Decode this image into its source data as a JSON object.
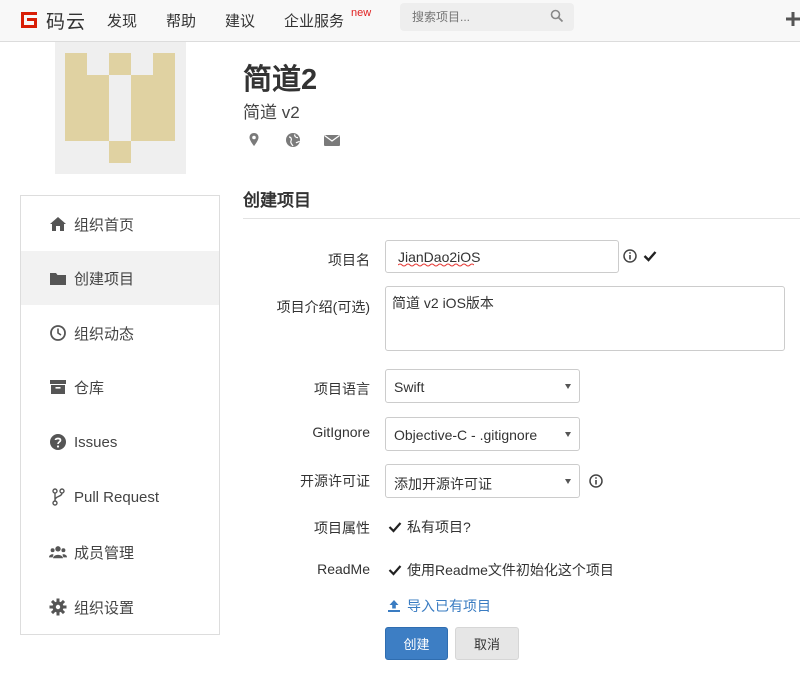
{
  "header": {
    "logo_text": "码云",
    "nav": [
      {
        "label": "发现"
      },
      {
        "label": "帮助"
      },
      {
        "label": "建议"
      },
      {
        "label": "企业服务"
      }
    ],
    "nav_badge": "new",
    "search_placeholder": "搜索项目...",
    "icons": {
      "search": "search-icon",
      "plus": "plus-icon",
      "logo": "gitee-logo"
    }
  },
  "org": {
    "name": "简道2",
    "subtitle": "简道 v2",
    "icons": [
      "map-marker-icon",
      "globe-icon",
      "envelope-icon"
    ],
    "avatar_color": "#e0d2a2"
  },
  "sidebar": {
    "items": [
      {
        "label": "组织首页",
        "icon": "home-icon",
        "active": false
      },
      {
        "label": "创建项目",
        "icon": "folder-icon",
        "active": true
      },
      {
        "label": "组织动态",
        "icon": "clock-icon",
        "active": false
      },
      {
        "label": "仓库",
        "icon": "archive-icon",
        "active": false
      },
      {
        "label": "Issues",
        "icon": "question-circle-icon",
        "active": false
      },
      {
        "label": "Pull Request",
        "icon": "code-fork-icon",
        "active": false
      },
      {
        "label": "成员管理",
        "icon": "users-icon",
        "active": false
      },
      {
        "label": "组织设置",
        "icon": "gear-icon",
        "active": false
      }
    ]
  },
  "form": {
    "title": "创建项目",
    "project_name": {
      "label": "项目名",
      "value": "JianDao2iOS"
    },
    "description": {
      "label": "项目介绍(可选)",
      "value": "简道 v2 iOS版本"
    },
    "language": {
      "label": "项目语言",
      "value": "Swift"
    },
    "gitignore": {
      "label": "GitIgnore",
      "value": "Objective-C - .gitignore"
    },
    "license": {
      "label": "开源许可证",
      "value": "添加开源许可证"
    },
    "visibility": {
      "label": "项目属性",
      "checkbox_label": "私有项目?",
      "checked": true
    },
    "readme": {
      "label": "ReadMe",
      "checkbox_label": "使用Readme文件初始化这个项目",
      "checked": true
    },
    "import_link": "导入已有项目",
    "submit_label": "创建",
    "cancel_label": "取消"
  },
  "colors": {
    "primary": "#3d7ec4",
    "logo_red": "#d81e06",
    "link": "#3a7cc2"
  }
}
